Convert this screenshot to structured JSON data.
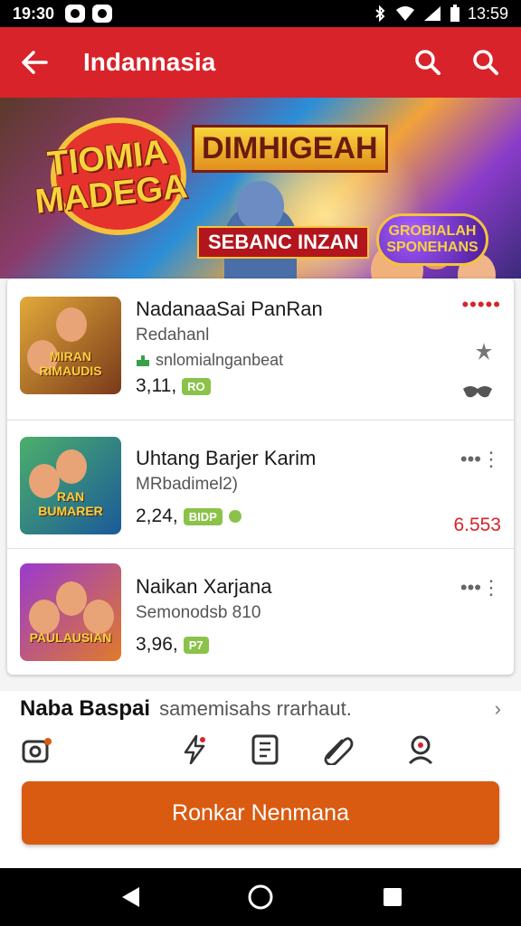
{
  "status_bar": {
    "time_left": "19:30",
    "time_right": "13:59"
  },
  "app_bar": {
    "title": "Indannasia"
  },
  "banner": {
    "logo_left": "TIOMIA MADEGA",
    "title": "DIMHIGEAH",
    "subtitle": "SEBANC INZAN",
    "badge": "GROBIALAH SPONEHANS"
  },
  "list": [
    {
      "name": "NadanaaSai PanRan",
      "developer": "Redahanl",
      "extra": "snlomialnganbeat",
      "rating": "3,11,",
      "pill": "RO",
      "thumb_label": "MIRAN RIMAUDIS",
      "thumb_colors": [
        "#e2a93a",
        "#7a3a1a"
      ]
    },
    {
      "name": "Uhtang Barjer Karim",
      "developer": "MRbadimel2)",
      "rating": "2,24,",
      "pill": "BIDP",
      "price": "6.553",
      "thumb_label": "RAN BUMARER",
      "thumb_colors": [
        "#4caf6a",
        "#1a5a9a"
      ]
    },
    {
      "name": "Naikan Xarjana",
      "developer": "Semonodsb 810",
      "rating": "3,96,",
      "pill": "P7",
      "thumb_label": "PAULAUSIAN",
      "thumb_colors": [
        "#9a3acf",
        "#e07a2a"
      ]
    }
  ],
  "section": {
    "heading": "Naba Baspai",
    "subheading": "samemisahs rrarhaut."
  },
  "cta": {
    "label": "Ronkar Nenmana"
  },
  "colors": {
    "brand_red": "#d8232a",
    "cta_orange": "#d95b12",
    "pill_green": "#8bc34a"
  }
}
